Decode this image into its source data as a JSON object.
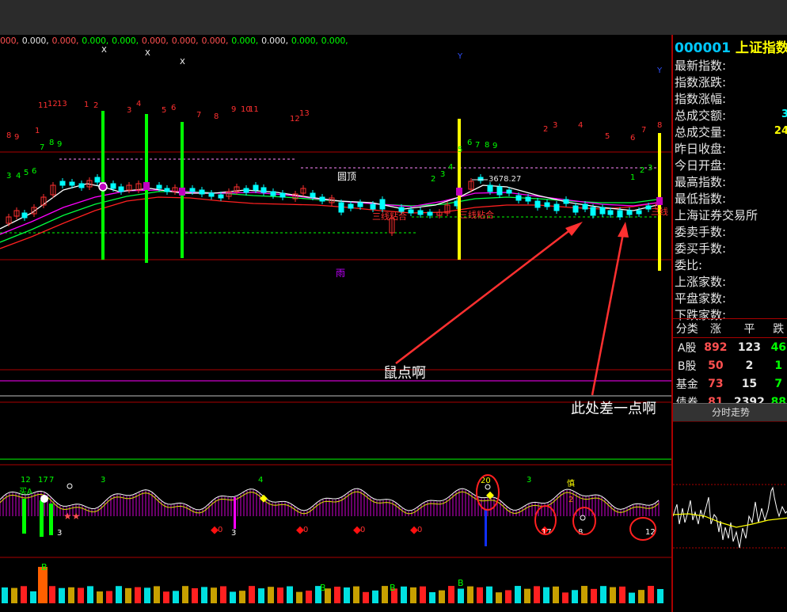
{
  "values_line": [
    {
      "text": "000,",
      "color": "#ff5050"
    },
    {
      "text": "0.000,",
      "color": "#e6e6e6"
    },
    {
      "text": "0.000,",
      "color": "#ff5050"
    },
    {
      "text": "0.000,",
      "color": "#00ff00"
    },
    {
      "text": "0.000,",
      "color": "#00ff00"
    },
    {
      "text": "0.000,",
      "color": "#ff5050"
    },
    {
      "text": "0.000,",
      "color": "#ff5050"
    },
    {
      "text": "0.000,",
      "color": "#ff5050"
    },
    {
      "text": "0.000,",
      "color": "#00ff00"
    },
    {
      "text": "0.000,",
      "color": "#e6e6e6"
    },
    {
      "text": "0.000,",
      "color": "#00ff00"
    },
    {
      "text": "0.000,",
      "color": "#00ff00"
    }
  ],
  "main_chart": {
    "price_label": "3678.27",
    "labels": {
      "yuanding": "圆顶",
      "yu": "雨",
      "sanxian_1": "三线粘合",
      "sanxian_2": "三线粘合",
      "sanxian_3": "三线"
    },
    "x_marks": [
      "X",
      "X",
      "X"
    ],
    "y_marks": [
      "Y",
      "Y"
    ],
    "red_numbers": [
      "8",
      "9",
      "11",
      "12",
      "13",
      "1",
      "2",
      "3",
      "4",
      "5",
      "6",
      "7",
      "8",
      "9",
      "10",
      "11",
      "12",
      "13",
      "1",
      "2",
      "3",
      "4",
      "5",
      "6",
      "7",
      "8"
    ],
    "green_numbers": [
      "3",
      "4",
      "5",
      "6",
      "7",
      "8",
      "9",
      "2",
      "3",
      "4",
      "5",
      "6",
      "7",
      "8",
      "9",
      "1",
      "2",
      "3"
    ]
  },
  "sub_chart": {
    "numbers": {
      "n12": "12",
      "n17": "17",
      "n7": "7",
      "n3a": "3",
      "n4": "4",
      "n20": "20",
      "n3b": "3",
      "n3c": "3",
      "n3d": "3",
      "n12b": "12",
      "n0a": "0",
      "n0b": "0",
      "n0c": "0",
      "n0d": "0",
      "n17b": "17",
      "n8": "8",
      "n2": "2",
      "qing": "慎",
      "yuan": "买A",
      "b1": "B",
      "b2": "B",
      "b3": "B"
    }
  },
  "annotations": {
    "mouse_click": "鼠点啊",
    "missing_point": "此处差一点啊"
  },
  "right_panel": {
    "code": "000001",
    "name": "上证指数",
    "fields": [
      {
        "label": "最新指数:",
        "value": "",
        "color": "#ffff00"
      },
      {
        "label": "指数涨跌:",
        "value": "",
        "color": "#ff5050"
      },
      {
        "label": "指数涨幅:",
        "value": "",
        "color": "#ff5050"
      },
      {
        "label": "总成交额:",
        "value": "3",
        "color": "#00ffff"
      },
      {
        "label": "总成交量:",
        "value": "24",
        "color": "#ffff00"
      },
      {
        "label": "昨日收盘:",
        "value": "",
        "color": "#e6e6e6"
      },
      {
        "label": "今日开盘:",
        "value": "",
        "color": "#e6e6e6"
      },
      {
        "label": "最高指数:",
        "value": "",
        "color": "#e6e6e6"
      },
      {
        "label": "最低指数:",
        "value": "",
        "color": "#e6e6e6"
      },
      {
        "label": "上海证券交易所",
        "value": "",
        "color": "#e6e6e6"
      },
      {
        "label": "委卖手数:",
        "value": "",
        "color": "#e6e6e6"
      },
      {
        "label": "委买手数:",
        "value": "",
        "color": "#e6e6e6"
      },
      {
        "label": "   委比:",
        "value": "",
        "color": "#e6e6e6"
      },
      {
        "label": "上涨家数:",
        "value": "",
        "color": "#e6e6e6"
      },
      {
        "label": "平盘家数:",
        "value": "",
        "color": "#e6e6e6"
      },
      {
        "label": "下跌家数:",
        "value": "",
        "color": "#e6e6e6"
      }
    ],
    "table": {
      "headers": [
        "分类",
        "涨",
        "平",
        "跌"
      ],
      "rows": [
        {
          "name": "A股",
          "up": "892",
          "flat": "123",
          "down": "46"
        },
        {
          "name": "B股",
          "up": "50",
          "flat": "2",
          "down": "1"
        },
        {
          "name": "基金",
          "up": "73",
          "flat": "15",
          "down": "7"
        },
        {
          "name": "债券",
          "up": "81",
          "flat": "2392",
          "down": "88"
        }
      ]
    },
    "minute_tab": "分时走势"
  },
  "colors": {
    "up": "#ff3030",
    "down": "#00ffff",
    "green": "#00ff00",
    "yellow": "#ffff00",
    "magenta": "#ff00ff",
    "white": "#ffffff"
  }
}
